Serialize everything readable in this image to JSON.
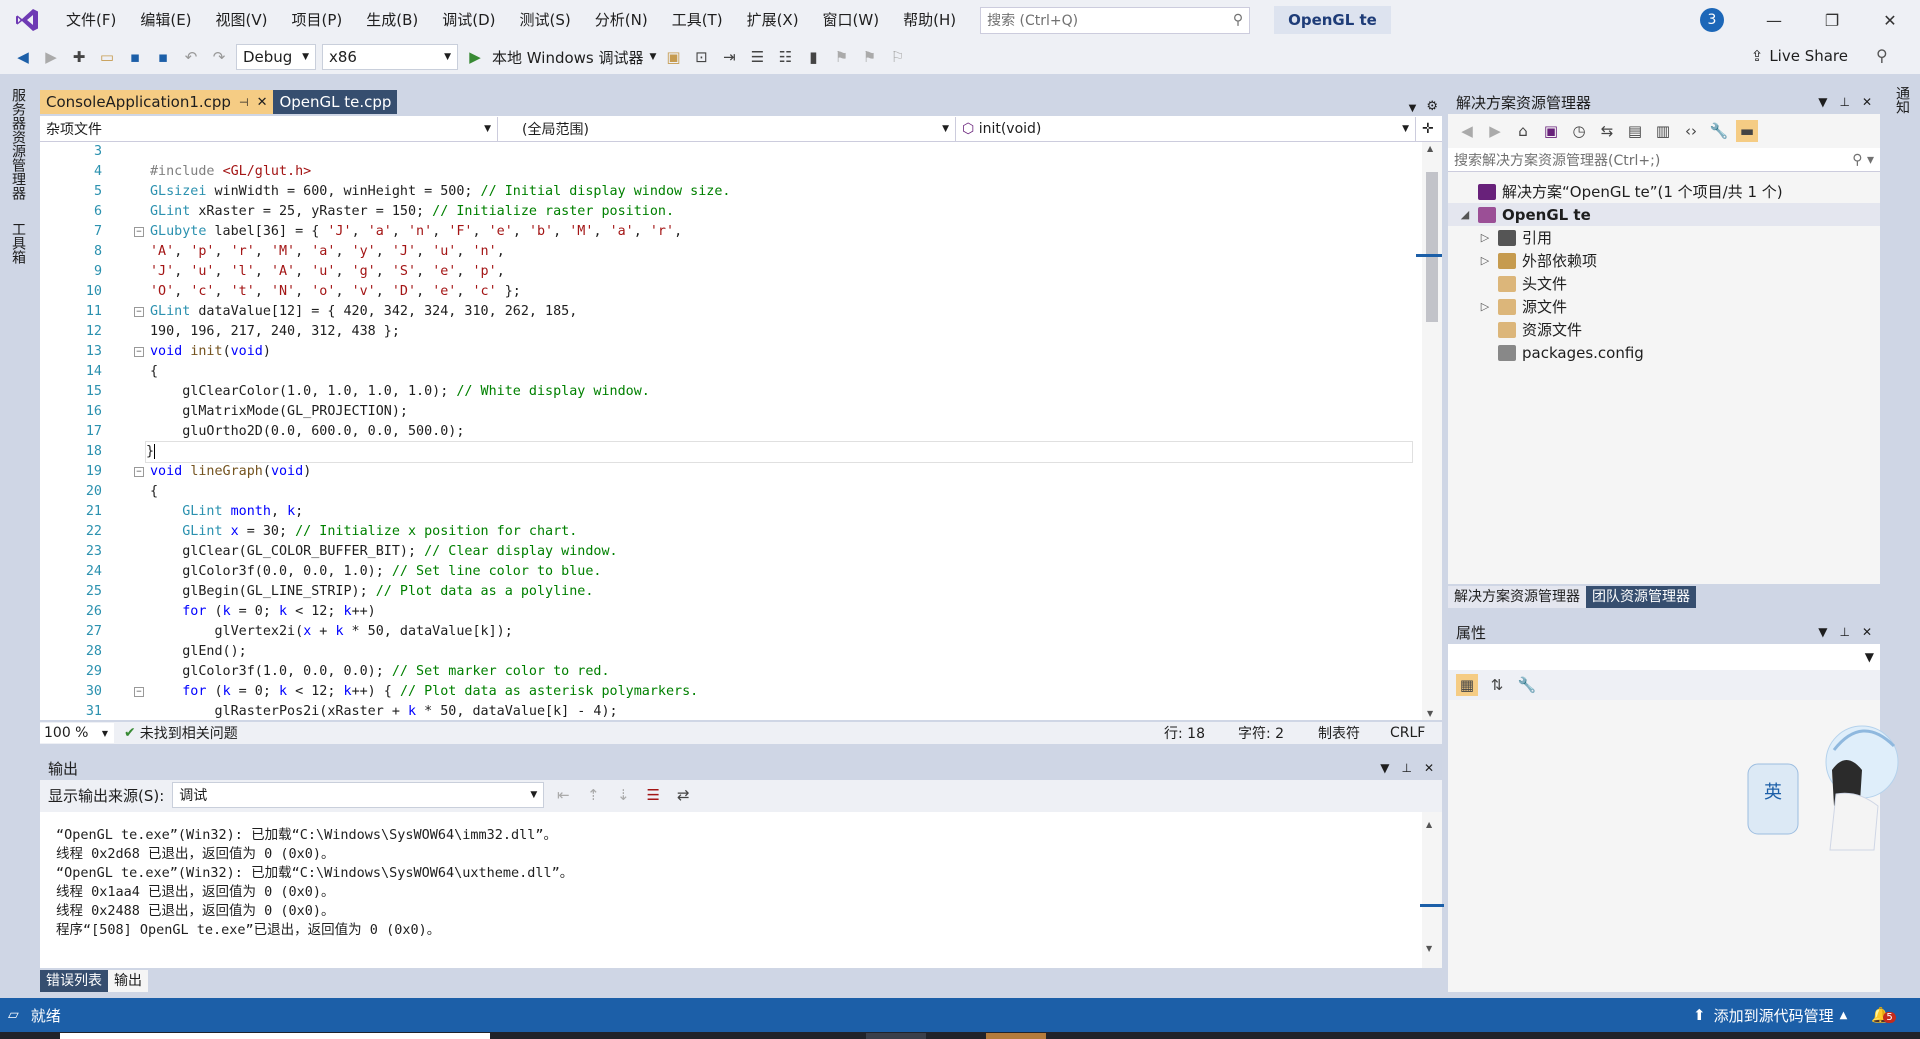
{
  "titlebar": {
    "menus": [
      "文件(F)",
      "编辑(E)",
      "视图(V)",
      "项目(P)",
      "生成(B)",
      "调试(D)",
      "测试(S)",
      "分析(N)",
      "工具(T)",
      "扩展(X)",
      "窗口(W)",
      "帮助(H)"
    ],
    "search_placeholder": "搜索 (Ctrl+Q)",
    "solution_badge": "OpenGL te",
    "notification_count": "3"
  },
  "toolbar": {
    "config": "Debug",
    "platform": "x86",
    "debugger": "本地 Windows 调试器",
    "live_share": "Live Share"
  },
  "left_strip": {
    "server_explorer": "服务器资源管理器",
    "toolbox": "工具箱"
  },
  "right_strip": {
    "notifications": "通知"
  },
  "editor": {
    "tabs": [
      {
        "label": "ConsoleApplication1.cpp",
        "active": true
      },
      {
        "label": "OpenGL te.cpp",
        "active": false
      }
    ],
    "nav": {
      "project": "杂项文件",
      "scope": "(全局范围)",
      "member": "init(void)"
    },
    "zoom": "100 %",
    "issues": "未找到相关问题",
    "line": "行: 18",
    "char": "字符: 2",
    "tabs_mode": "制表符",
    "eol": "CRLF",
    "lines": [
      {
        "n": "3",
        "t": ""
      },
      {
        "n": "4",
        "t": "#include <GL/glut.h>"
      },
      {
        "n": "5",
        "t": "GLsizei winWidth = 600, winHeight = 500; // Initial display window size."
      },
      {
        "n": "6",
        "t": "GLint xRaster = 25, yRaster = 150; // Initialize raster position."
      },
      {
        "n": "7",
        "t": "GLubyte label[36] = { 'J', 'a', 'n', 'F', 'e', 'b', 'M', 'a', 'r',",
        "f": "−"
      },
      {
        "n": "8",
        "t": "'A', 'p', 'r', 'M', 'a', 'y', 'J', 'u', 'n',"
      },
      {
        "n": "9",
        "t": "'J', 'u', 'l', 'A', 'u', 'g', 'S', 'e', 'p',"
      },
      {
        "n": "10",
        "t": "'O', 'c', 't', 'N', 'o', 'v', 'D', 'e', 'c' };"
      },
      {
        "n": "11",
        "t": "GLint dataValue[12] = { 420, 342, 324, 310, 262, 185,",
        "f": "−"
      },
      {
        "n": "12",
        "t": "190, 196, 217, 240, 312, 438 };"
      },
      {
        "n": "13",
        "t": "void init(void)",
        "f": "−"
      },
      {
        "n": "14",
        "t": "{"
      },
      {
        "n": "15",
        "t": "    glClearColor(1.0, 1.0, 1.0, 1.0); // White display window."
      },
      {
        "n": "16",
        "t": "    glMatrixMode(GL_PROJECTION);"
      },
      {
        "n": "17",
        "t": "    gluOrtho2D(0.0, 600.0, 0.0, 500.0);"
      },
      {
        "n": "18",
        "t": "}"
      },
      {
        "n": "19",
        "t": "void lineGraph(void)",
        "f": "−"
      },
      {
        "n": "20",
        "t": "{"
      },
      {
        "n": "21",
        "t": "    GLint month, k;"
      },
      {
        "n": "22",
        "t": "    GLint x = 30; // Initialize x position for chart."
      },
      {
        "n": "23",
        "t": "    glClear(GL_COLOR_BUFFER_BIT); // Clear display window."
      },
      {
        "n": "24",
        "t": "    glColor3f(0.0, 0.0, 1.0); // Set line color to blue."
      },
      {
        "n": "25",
        "t": "    glBegin(GL_LINE_STRIP); // Plot data as a polyline."
      },
      {
        "n": "26",
        "t": "    for (k = 0; k < 12; k++)"
      },
      {
        "n": "27",
        "t": "        glVertex2i(x + k * 50, dataValue[k]);"
      },
      {
        "n": "28",
        "t": "    glEnd();"
      },
      {
        "n": "29",
        "t": "    glColor3f(1.0, 0.0, 0.0); // Set marker color to red."
      },
      {
        "n": "30",
        "t": "    for (k = 0; k < 12; k++) { // Plot data as asterisk polymarkers.",
        "f": "−"
      },
      {
        "n": "31",
        "t": "        glRasterPos2i(xRaster + k * 50, dataValue[k] - 4);"
      }
    ]
  },
  "output": {
    "title": "输出",
    "source_label": "显示输出来源(S):",
    "source_value": "调试",
    "text": "“OpenGL te.exe”(Win32): 已加载“C:\\Windows\\SysWOW64\\imm32.dll”。\n线程 0x2d68 已退出，返回值为 0 (0x0)。\n“OpenGL te.exe”(Win32): 已加载“C:\\Windows\\SysWOW64\\uxtheme.dll”。\n线程 0x1aa4 已退出，返回值为 0 (0x0)。\n线程 0x2488 已退出，返回值为 0 (0x0)。\n程序“[508] OpenGL te.exe”已退出，返回值为 0 (0x0)。",
    "tabs": [
      {
        "label": "错误列表",
        "active": false
      },
      {
        "label": "输出",
        "active": true
      }
    ]
  },
  "solution_explorer": {
    "title": "解决方案资源管理器",
    "search_placeholder": "搜索解决方案资源管理器(Ctrl+;)",
    "nodes": [
      {
        "label": "解决方案“OpenGL te”(1 个项目/共 1 个)",
        "level": 0,
        "arrow": "",
        "icon": "solution-icon",
        "color": "#68217a"
      },
      {
        "label": "OpenGL te",
        "level": 0,
        "arrow": "◢",
        "icon": "project-icon",
        "color": "#9b4f96",
        "bold": true,
        "sel": true
      },
      {
        "label": "引用",
        "level": 1,
        "arrow": "▷",
        "icon": "references-icon",
        "color": "#555"
      },
      {
        "label": "外部依赖项",
        "level": 1,
        "arrow": "▷",
        "icon": "external-deps-icon",
        "color": "#c69b4f"
      },
      {
        "label": "头文件",
        "level": 1,
        "arrow": "",
        "icon": "folder-icon",
        "color": "#dcb67a"
      },
      {
        "label": "源文件",
        "level": 1,
        "arrow": "▷",
        "icon": "folder-icon",
        "color": "#dcb67a"
      },
      {
        "label": "资源文件",
        "level": 1,
        "arrow": "",
        "icon": "folder-icon",
        "color": "#dcb67a"
      },
      {
        "label": "packages.config",
        "level": 1,
        "arrow": "",
        "icon": "config-file-icon",
        "color": "#888"
      }
    ],
    "tabs": [
      {
        "label": "解决方案资源管理器",
        "active": true
      },
      {
        "label": "团队资源管理器",
        "active": false
      }
    ]
  },
  "properties": {
    "title": "属性"
  },
  "ime": {
    "label": "英"
  },
  "statusbar": {
    "ready": "就绪",
    "source_control": "添加到源代码管理",
    "notif_count": "5"
  }
}
